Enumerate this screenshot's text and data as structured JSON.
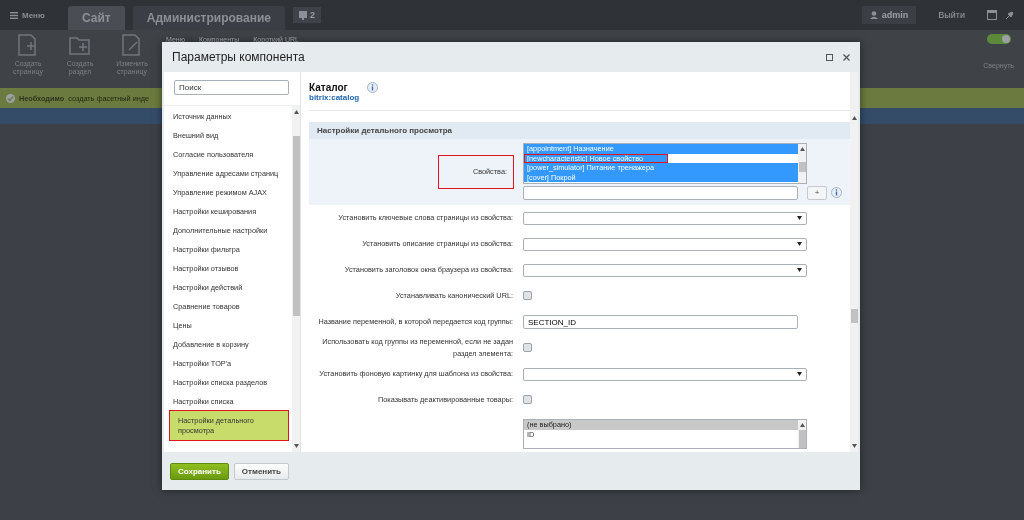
{
  "admin_panel": {
    "menu_button": "Меню",
    "tabs": [
      {
        "label": "Сайт",
        "selected": true
      },
      {
        "label": "Администрирование",
        "selected": false
      }
    ],
    "notifications_count": "2",
    "user": "admin",
    "logout": "Выйти",
    "toolbar": [
      {
        "label": "Создать страницу",
        "kind": "page-add"
      },
      {
        "label": "Создать раздел",
        "kind": "folder-add"
      },
      {
        "label": "Изменить страницу",
        "kind": "page-edit"
      }
    ],
    "toolbar_menus": [
      "Меню",
      "Компоненты",
      "Короткий URL"
    ],
    "collapse": "Свернуть"
  },
  "notice": {
    "title": "Необходимо",
    "link": "создать фасетный инде"
  },
  "dialog": {
    "title": "Параметры компонента",
    "search": {
      "placeholder": "Поиск"
    },
    "sections": [
      {
        "label": "Источник данных",
        "selected": false
      },
      {
        "label": "Внешний вид",
        "selected": false
      },
      {
        "label": "Согласие пользователя",
        "selected": false
      },
      {
        "label": "Управление адресами страниц",
        "selected": false
      },
      {
        "label": "Управление режимом AJAX",
        "selected": false
      },
      {
        "label": "Настройки кеширования",
        "selected": false
      },
      {
        "label": "Дополнительные настройки",
        "selected": false
      },
      {
        "label": "Настройки фильтра",
        "selected": false
      },
      {
        "label": "Настройки отзывов",
        "selected": false
      },
      {
        "label": "Настройки действий",
        "selected": false
      },
      {
        "label": "Сравнение товаров",
        "selected": false
      },
      {
        "label": "Цены",
        "selected": false
      },
      {
        "label": "Добавление в корзину",
        "selected": false
      },
      {
        "label": "Настройки TOP'а",
        "selected": false
      },
      {
        "label": "Настройки списка разделов",
        "selected": false
      },
      {
        "label": "Настройки списка",
        "selected": false
      },
      {
        "label": "Настройки детального просмотра",
        "selected": true
      }
    ],
    "component": {
      "name": "Каталог",
      "code": "bitrix:catalog"
    },
    "group": {
      "title": "Настройки детального просмотра"
    },
    "fields": [
      {
        "kind": "multiselect",
        "label": "Свойства:",
        "highlighted": true,
        "active": true,
        "focused": true,
        "add_button": "+",
        "options": [
          {
            "text": "[appointment] Назначение",
            "selected": true,
            "highlighted": false
          },
          {
            "text": "[newcharacteristic] Новое свойство",
            "selected": true,
            "highlighted": true
          },
          {
            "text": "[power_simulator] Питание тренажера",
            "selected": true,
            "highlighted": false
          },
          {
            "text": "[cover] Покрой",
            "selected": true,
            "highlighted": false
          }
        ]
      },
      {
        "kind": "select",
        "label": "Установить ключевые слова страницы из свойства:"
      },
      {
        "kind": "select",
        "label": "Установить описание страницы из свойства:"
      },
      {
        "kind": "select",
        "label": "Установить заголовок окна браузера из свойства:"
      },
      {
        "kind": "checkbox",
        "label": "Устанавливать канонический URL:",
        "checked": false
      },
      {
        "kind": "text",
        "label": "Название переменной, в которой передается код группы:",
        "value": "SECTION_ID"
      },
      {
        "kind": "checkbox",
        "label": "Использовать код группы из переменной, если не задан раздел элемента:",
        "checked": false
      },
      {
        "kind": "select",
        "label": "Установить фоновую картинку для шаблона из свойства:"
      },
      {
        "kind": "checkbox",
        "label": "Показывать деактивированные товары:",
        "checked": false
      },
      {
        "kind": "listbox",
        "focused": false,
        "options": [
          {
            "text": "(не выбрано)",
            "selected": true,
            "highlighted": false
          },
          {
            "text": "ID",
            "selected": false,
            "highlighted": false
          }
        ]
      }
    ],
    "buttons": [
      {
        "label": "Сохранить",
        "kind": "primary"
      },
      {
        "label": "Отменить",
        "kind": "secondary"
      }
    ]
  }
}
